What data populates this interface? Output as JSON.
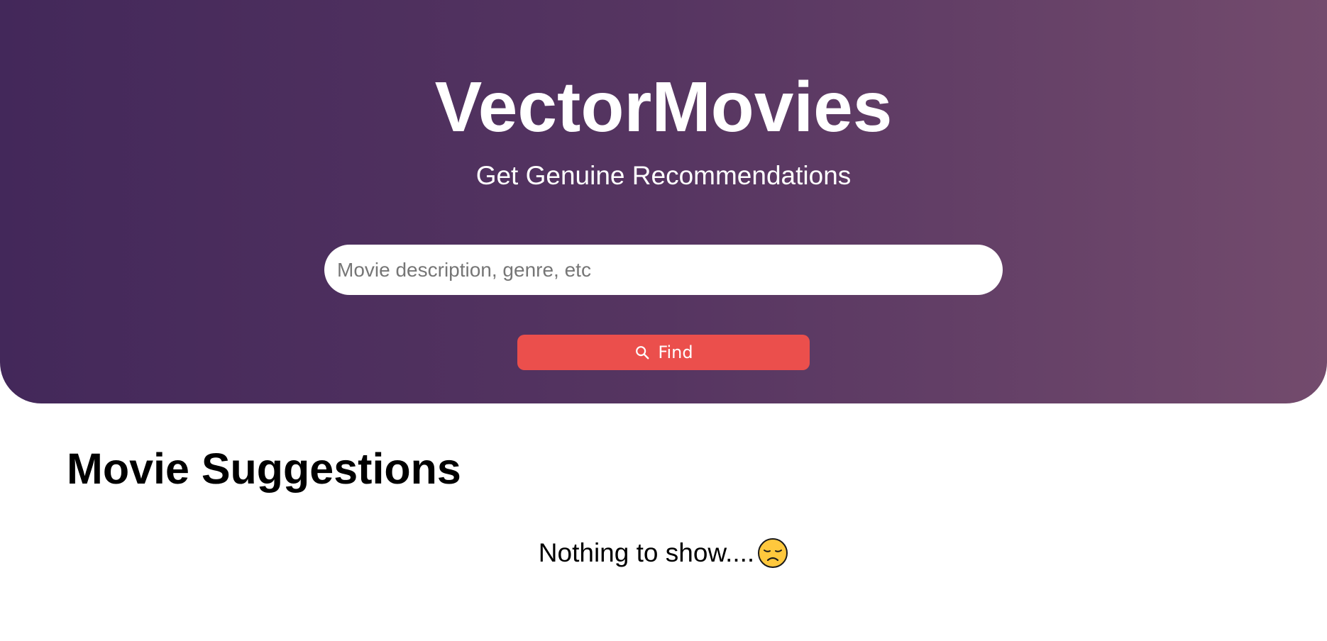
{
  "header": {
    "title": "VectorMovies",
    "subtitle": "Get Genuine Recommendations"
  },
  "search": {
    "placeholder": "Movie description, genre, etc",
    "value": "",
    "button_label": "Find",
    "button_icon": "search-icon"
  },
  "suggestions": {
    "heading": "Movie Suggestions",
    "empty_text": "Nothing to show....",
    "empty_icon": "pensive-face-icon"
  },
  "colors": {
    "hero_gradient_start": "#43285a",
    "hero_gradient_end": "#734b6d",
    "button": "#eb4f4c",
    "text_on_hero": "#ffffff"
  }
}
